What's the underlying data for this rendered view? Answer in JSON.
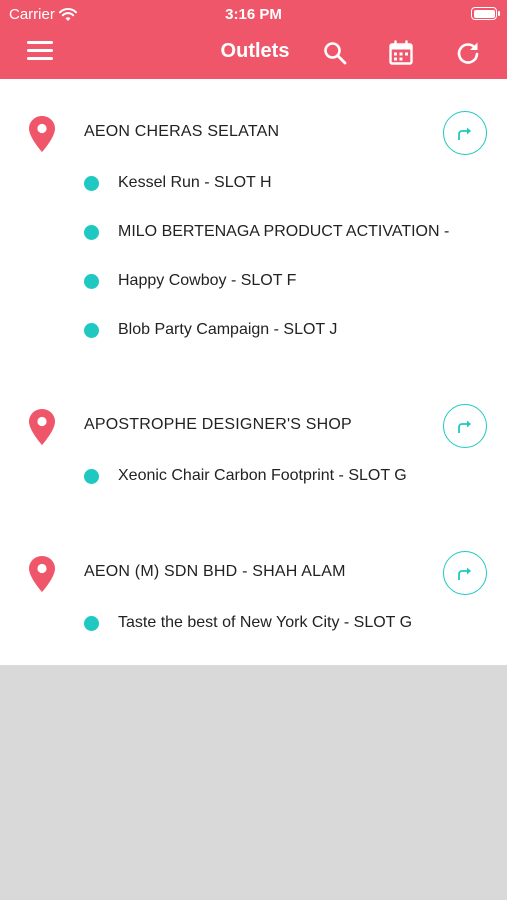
{
  "status_bar": {
    "carrier": "Carrier",
    "time": "3:16 PM"
  },
  "header": {
    "title": "Outlets",
    "background": "#f0566a",
    "icons": [
      "menu-icon",
      "search-icon",
      "calendar-icon",
      "refresh-icon"
    ]
  },
  "accent_color": "#1fc9c1",
  "outlets": [
    {
      "name": "AEON CHERAS SELATAN",
      "tasks": [
        "Kessel Run - SLOT H",
        "MILO BERTENAGA PRODUCT ACTIVATION -",
        "Happy Cowboy - SLOT F",
        "Blob Party Campaign - SLOT J"
      ]
    },
    {
      "name": "APOSTROPHE DESIGNER'S SHOP",
      "tasks": [
        "Xeonic Chair Carbon Footprint - SLOT G"
      ]
    },
    {
      "name": "AEON (M) SDN BHD - SHAH ALAM",
      "tasks": [
        "Taste the best of New York City - SLOT G"
      ]
    }
  ]
}
